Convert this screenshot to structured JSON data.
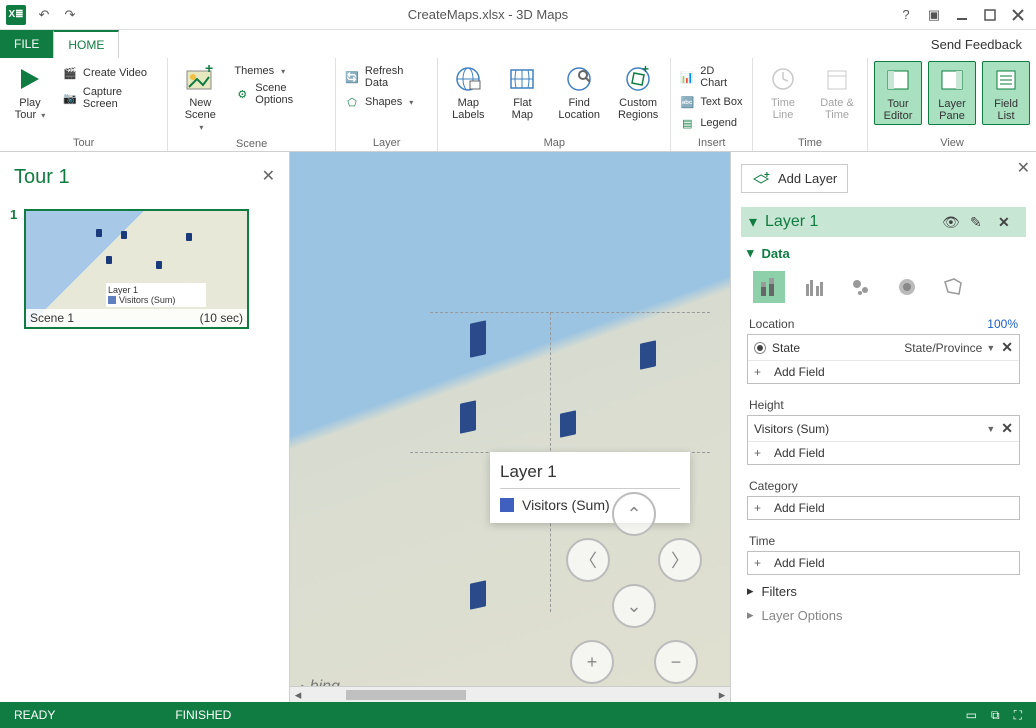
{
  "title": "CreateMaps.xlsx - 3D Maps",
  "tabs": {
    "file": "FILE",
    "home": "HOME",
    "feedback": "Send Feedback"
  },
  "ribbon": {
    "tour": {
      "label": "Tour",
      "play": "Play\nTour",
      "createVideo": "Create Video",
      "captureScreen": "Capture Screen"
    },
    "scene": {
      "label": "Scene",
      "newScene": "New\nScene",
      "themes": "Themes",
      "sceneOptions": "Scene Options"
    },
    "layer": {
      "label": "Layer",
      "refreshData": "Refresh Data",
      "shapes": "Shapes"
    },
    "map": {
      "label": "Map",
      "mapLabels": "Map\nLabels",
      "flatMap": "Flat\nMap",
      "findLocation": "Find\nLocation",
      "customRegions": "Custom\nRegions"
    },
    "insert": {
      "label": "Insert",
      "chart2d": "2D Chart",
      "textBox": "Text Box",
      "legend": "Legend"
    },
    "time": {
      "label": "Time",
      "timeLine": "Time\nLine",
      "dateTime": "Date &\nTime"
    },
    "view": {
      "label": "View",
      "tourEditor": "Tour\nEditor",
      "layerPane": "Layer\nPane",
      "fieldList": "Field\nList"
    }
  },
  "tourPanel": {
    "title": "Tour 1",
    "sceneNum": "1",
    "sceneName": "Scene 1",
    "sceneDuration": "(10 sec)",
    "thumbLegend": {
      "title": "Layer 1",
      "item": "Visitors (Sum)"
    }
  },
  "mapLegend": {
    "title": "Layer 1",
    "item": "Visitors (Sum)"
  },
  "bing": "bing",
  "layerPanel": {
    "addLayer": "Add Layer",
    "layerName": "Layer 1",
    "data": "Data",
    "location": {
      "label": "Location",
      "pct": "100%",
      "field": "State",
      "type": "State/Province",
      "addField": "Add Field"
    },
    "height": {
      "label": "Height",
      "field": "Visitors (Sum)",
      "addField": "Add Field"
    },
    "category": {
      "label": "Category",
      "addField": "Add Field"
    },
    "time": {
      "label": "Time",
      "addField": "Add Field"
    },
    "filters": "Filters",
    "layerOptions": "Layer Options"
  },
  "status": {
    "ready": "READY",
    "finished": "FINISHED"
  }
}
